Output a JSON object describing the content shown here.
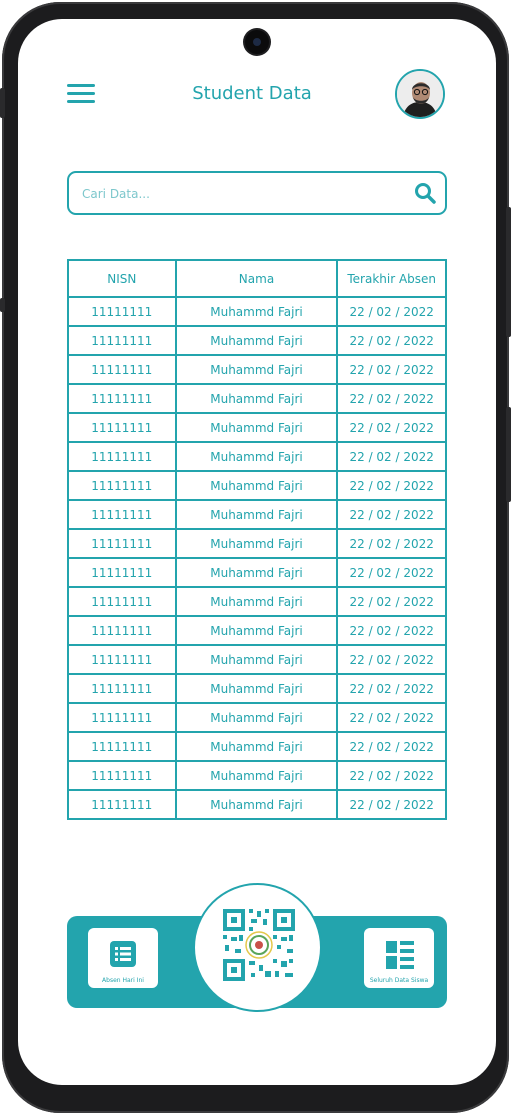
{
  "header": {
    "title": "Student Data"
  },
  "search": {
    "placeholder": "Cari Data...",
    "value": ""
  },
  "table": {
    "columns": [
      "NISN",
      "Nama",
      "Terakhir Absen"
    ],
    "rows": [
      [
        "11111111",
        "Muhammd Fajri",
        "22 / 02 / 2022"
      ],
      [
        "11111111",
        "Muhammd Fajri",
        "22 / 02 / 2022"
      ],
      [
        "11111111",
        "Muhammd Fajri",
        "22 / 02 / 2022"
      ],
      [
        "11111111",
        "Muhammd Fajri",
        "22 / 02 / 2022"
      ],
      [
        "11111111",
        "Muhammd Fajri",
        "22 / 02 / 2022"
      ],
      [
        "11111111",
        "Muhammd Fajri",
        "22 / 02 / 2022"
      ],
      [
        "11111111",
        "Muhammd Fajri",
        "22 / 02 / 2022"
      ],
      [
        "11111111",
        "Muhammd Fajri",
        "22 / 02 / 2022"
      ],
      [
        "11111111",
        "Muhammd Fajri",
        "22 / 02 / 2022"
      ],
      [
        "11111111",
        "Muhammd Fajri",
        "22 / 02 / 2022"
      ],
      [
        "11111111",
        "Muhammd Fajri",
        "22 / 02 / 2022"
      ],
      [
        "11111111",
        "Muhammd Fajri",
        "22 / 02 / 2022"
      ],
      [
        "11111111",
        "Muhammd Fajri",
        "22 / 02 / 2022"
      ],
      [
        "11111111",
        "Muhammd Fajri",
        "22 / 02 / 2022"
      ],
      [
        "11111111",
        "Muhammd Fajri",
        "22 / 02 / 2022"
      ],
      [
        "11111111",
        "Muhammd Fajri",
        "22 / 02 / 2022"
      ],
      [
        "11111111",
        "Muhammd Fajri",
        "22 / 02 / 2022"
      ],
      [
        "11111111",
        "Muhammd Fajri",
        "22 / 02 / 2022"
      ]
    ]
  },
  "bottom_nav": {
    "left_label": "Absen Hari Ini",
    "right_label": "Seluruh Data Siswa"
  },
  "icons": {
    "menu": "hamburger-menu-icon",
    "search": "search-icon",
    "left_tile": "list-icon",
    "right_tile": "grid-list-icon",
    "center": "qr-code-icon"
  },
  "colors": {
    "accent": "#23a4ad"
  }
}
